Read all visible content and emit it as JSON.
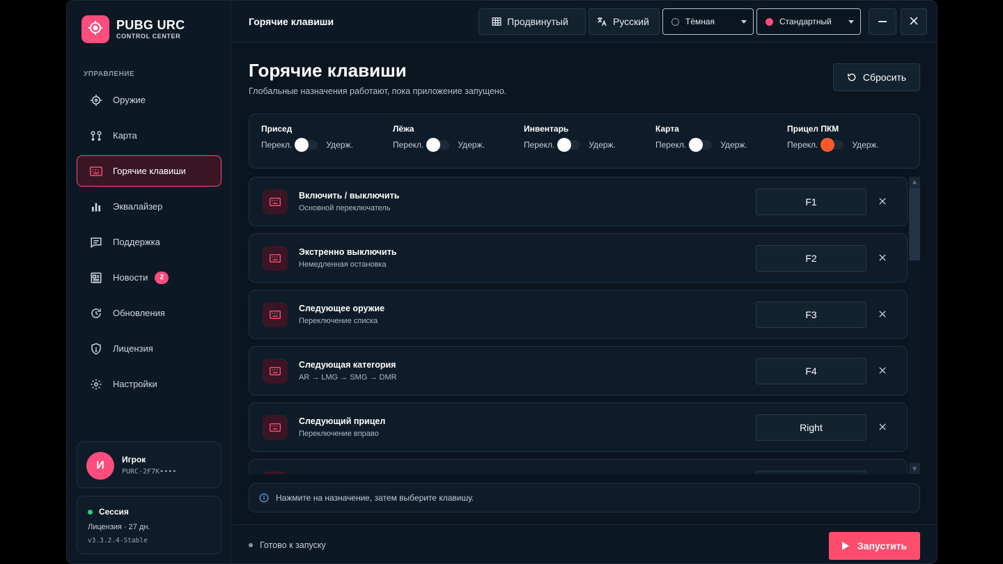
{
  "app": {
    "brand": "PUBG URC",
    "brand_sub": "CONTROL CENTER",
    "accent": "#ff4d7d"
  },
  "sidebar": {
    "section_label": "УПРАВЛЕНИЕ",
    "items": [
      {
        "label": "Оружие",
        "icon": "crosshair-icon"
      },
      {
        "label": "Карта",
        "icon": "map-pins-icon"
      },
      {
        "label": "Горячие клавиши",
        "icon": "keyboard-icon",
        "active": true
      },
      {
        "label": "Эквалайзер",
        "icon": "bar-chart-icon"
      },
      {
        "label": "Поддержка",
        "icon": "chat-icon"
      },
      {
        "label": "Новости",
        "icon": "newspaper-icon",
        "badge": "2"
      },
      {
        "label": "Обновления",
        "icon": "refresh-icon"
      },
      {
        "label": "Лицензия",
        "icon": "shield-icon"
      },
      {
        "label": "Настройки",
        "icon": "gear-icon"
      }
    ],
    "user": {
      "initial": "И",
      "name": "Игрок",
      "key": "PURC-2F7K••••"
    },
    "session": {
      "title": "Сессия",
      "license": "Лицензия · 27 дн.",
      "version": "v3.3.2.4-Stable"
    }
  },
  "header": {
    "title": "Горячие клавиши",
    "mode_label": "Продвинутый",
    "language_label": "Русский",
    "theme_value": "Тёмная",
    "scheme_value": "Стандартный"
  },
  "main": {
    "title": "Горячие клавиши",
    "subtitle": "Глобальные назначения работают, пока приложение запущено.",
    "reset_label": "Сбросить",
    "toggles": [
      {
        "label": "Присед",
        "left": "Перекл.",
        "right": "Удерж.",
        "on": false
      },
      {
        "label": "Лёжа",
        "left": "Перекл.",
        "right": "Удерж.",
        "on": false
      },
      {
        "label": "Инвентарь",
        "left": "Перекл.",
        "right": "Удерж.",
        "on": false
      },
      {
        "label": "Карта",
        "left": "Перекл.",
        "right": "Удерж.",
        "on": false
      },
      {
        "label": "Прицел ПКМ",
        "left": "Перекл.",
        "right": "Удерж.",
        "on": true
      }
    ],
    "bindings": [
      {
        "title": "Включить / выключить",
        "subtitle": "Основной переключатель",
        "key": "F1"
      },
      {
        "title": "Экстренно выключить",
        "subtitle": "Немедленная остановка",
        "key": "F2"
      },
      {
        "title": "Следующее оружие",
        "subtitle": "Переключение списка",
        "key": "F3"
      },
      {
        "title": "Следующая категория",
        "subtitle": "AR → LMG → SMG → DMR",
        "key": "F4"
      },
      {
        "title": "Следующий прицел",
        "subtitle": "Переключение вправо",
        "key": "Right"
      }
    ],
    "info": "Нажмите на назначение, затем выберите клавишу."
  },
  "footer": {
    "status": "Готово к запуску",
    "launch_label": "Запустить"
  }
}
